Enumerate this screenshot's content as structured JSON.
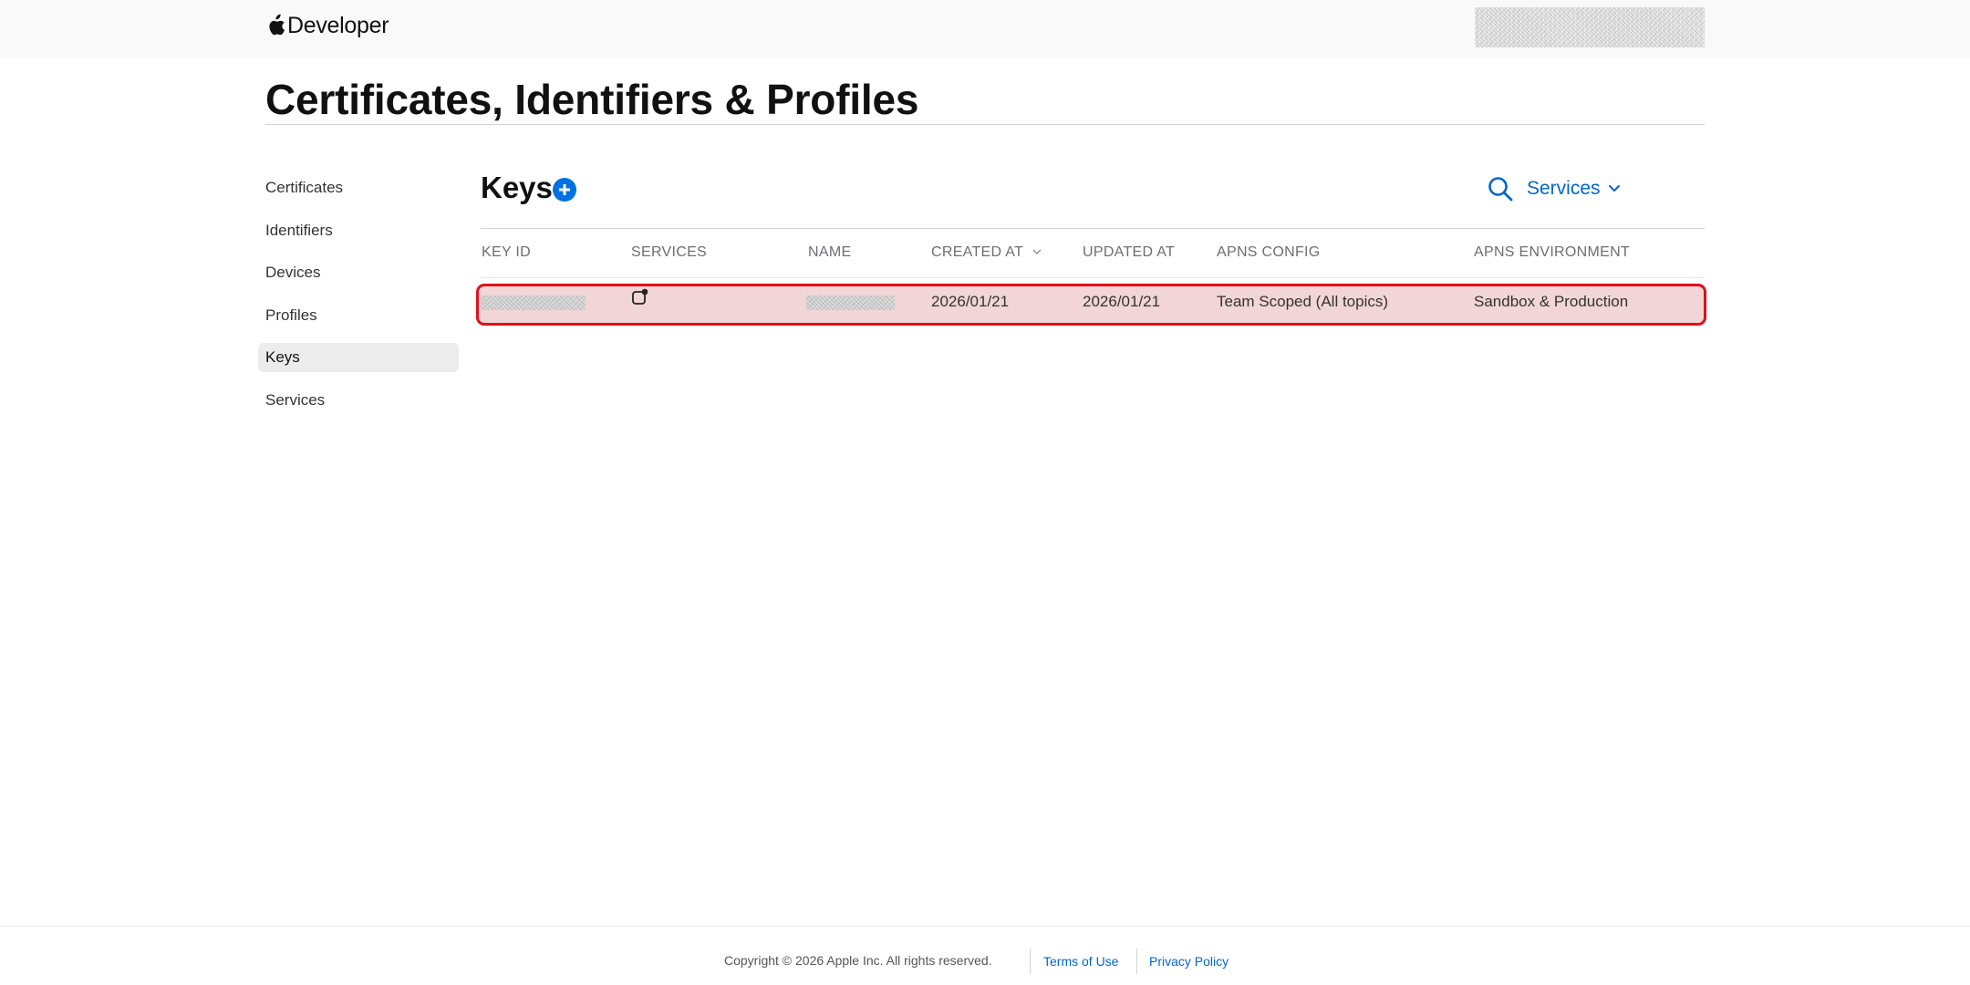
{
  "header": {
    "brand_label": "Developer"
  },
  "page": {
    "title": "Certificates, Identifiers & Profiles"
  },
  "sidebar": {
    "items": [
      {
        "label": "Certificates"
      },
      {
        "label": "Identifiers"
      },
      {
        "label": "Devices"
      },
      {
        "label": "Profiles"
      },
      {
        "label": "Keys",
        "active": true
      },
      {
        "label": "Services"
      }
    ]
  },
  "main": {
    "title": "Keys",
    "filter_label": "Services"
  },
  "table": {
    "columns": [
      "KEY ID",
      "SERVICES",
      "NAME",
      "CREATED AT",
      "UPDATED AT",
      "APNS CONFIG",
      "APNS ENVIRONMENT"
    ],
    "sorted_column": "CREATED AT",
    "rows": [
      {
        "key_id": "",
        "services_icon": "push-notification-icon",
        "name": "",
        "created_at": "2026/01/21",
        "updated_at": "2026/01/21",
        "apns_config": "Team Scoped (All topics)",
        "apns_environment": "Sandbox & Production",
        "highlighted": true
      }
    ]
  },
  "footer": {
    "copyright": "Copyright © 2026 Apple Inc. All rights reserved.",
    "terms_label": "Terms of Use",
    "privacy_label": "Privacy Policy"
  },
  "colors": {
    "accent": "#0071e3",
    "link": "#0066cc",
    "highlight_border": "#e0101a",
    "highlight_fill": "#f2d5d6",
    "active_nav": "#ececec"
  }
}
